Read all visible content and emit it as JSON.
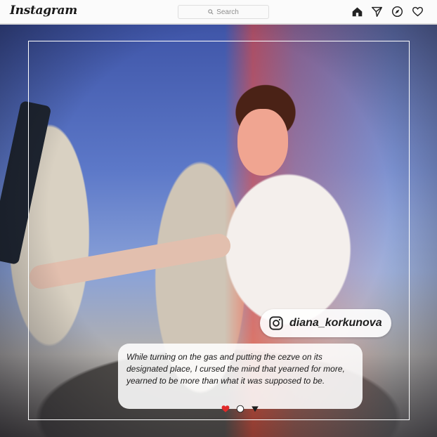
{
  "header": {
    "logo": "Instagram",
    "search_placeholder": "Search",
    "nav": [
      "home-icon",
      "direct-icon",
      "explore-icon",
      "heart-icon"
    ]
  },
  "post": {
    "username": "diana_korkunova",
    "caption": "While turning on the gas and putting the cezve on its designated place, I cursed the mind that yearned for more, yearned to be more than what it was supposed to be.",
    "carousel": {
      "count": 3,
      "active_index": 1
    }
  },
  "colors": {
    "frame": "#ffffff",
    "sky": "#4a63b5",
    "red_glow": "#ff4a2d",
    "heart": "#e02a2a"
  }
}
